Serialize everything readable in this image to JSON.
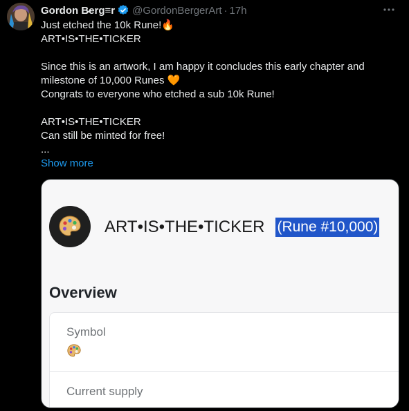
{
  "tweet": {
    "display_name": "Gordon B̷erg≡r",
    "handle": "@GordonBergerArt",
    "separator": "·",
    "time": "17h",
    "lines": [
      "Just etched the 10k Rune!🔥",
      "ART•IS•THE•TICKER",
      "",
      "Since this is an artwork, I am happy it concludes this early chapter and",
      "milestone of 10,000 Runes 🧡",
      "Congrats to everyone who etched a sub 10k Rune!",
      "",
      "ART•IS•THE•TICKER",
      "Can still be minted for free!",
      "..."
    ],
    "show_more": "Show more"
  },
  "card": {
    "rune_name": "ART•IS•THE•TICKER",
    "rune_number": "(Rune #10,000)",
    "overview_heading": "Overview",
    "symbol_label": "Symbol",
    "current_supply_label": "Current supply"
  },
  "icons": {
    "verified": "verified-badge-icon",
    "more": "more-options-icon",
    "palette": "artist-palette-icon"
  },
  "colors": {
    "background": "#000000",
    "text": "#e7e9ea",
    "secondary_text": "#71767b",
    "link": "#1d9bf0",
    "verified": "#1d9bf0",
    "selection": "#2156c9"
  }
}
